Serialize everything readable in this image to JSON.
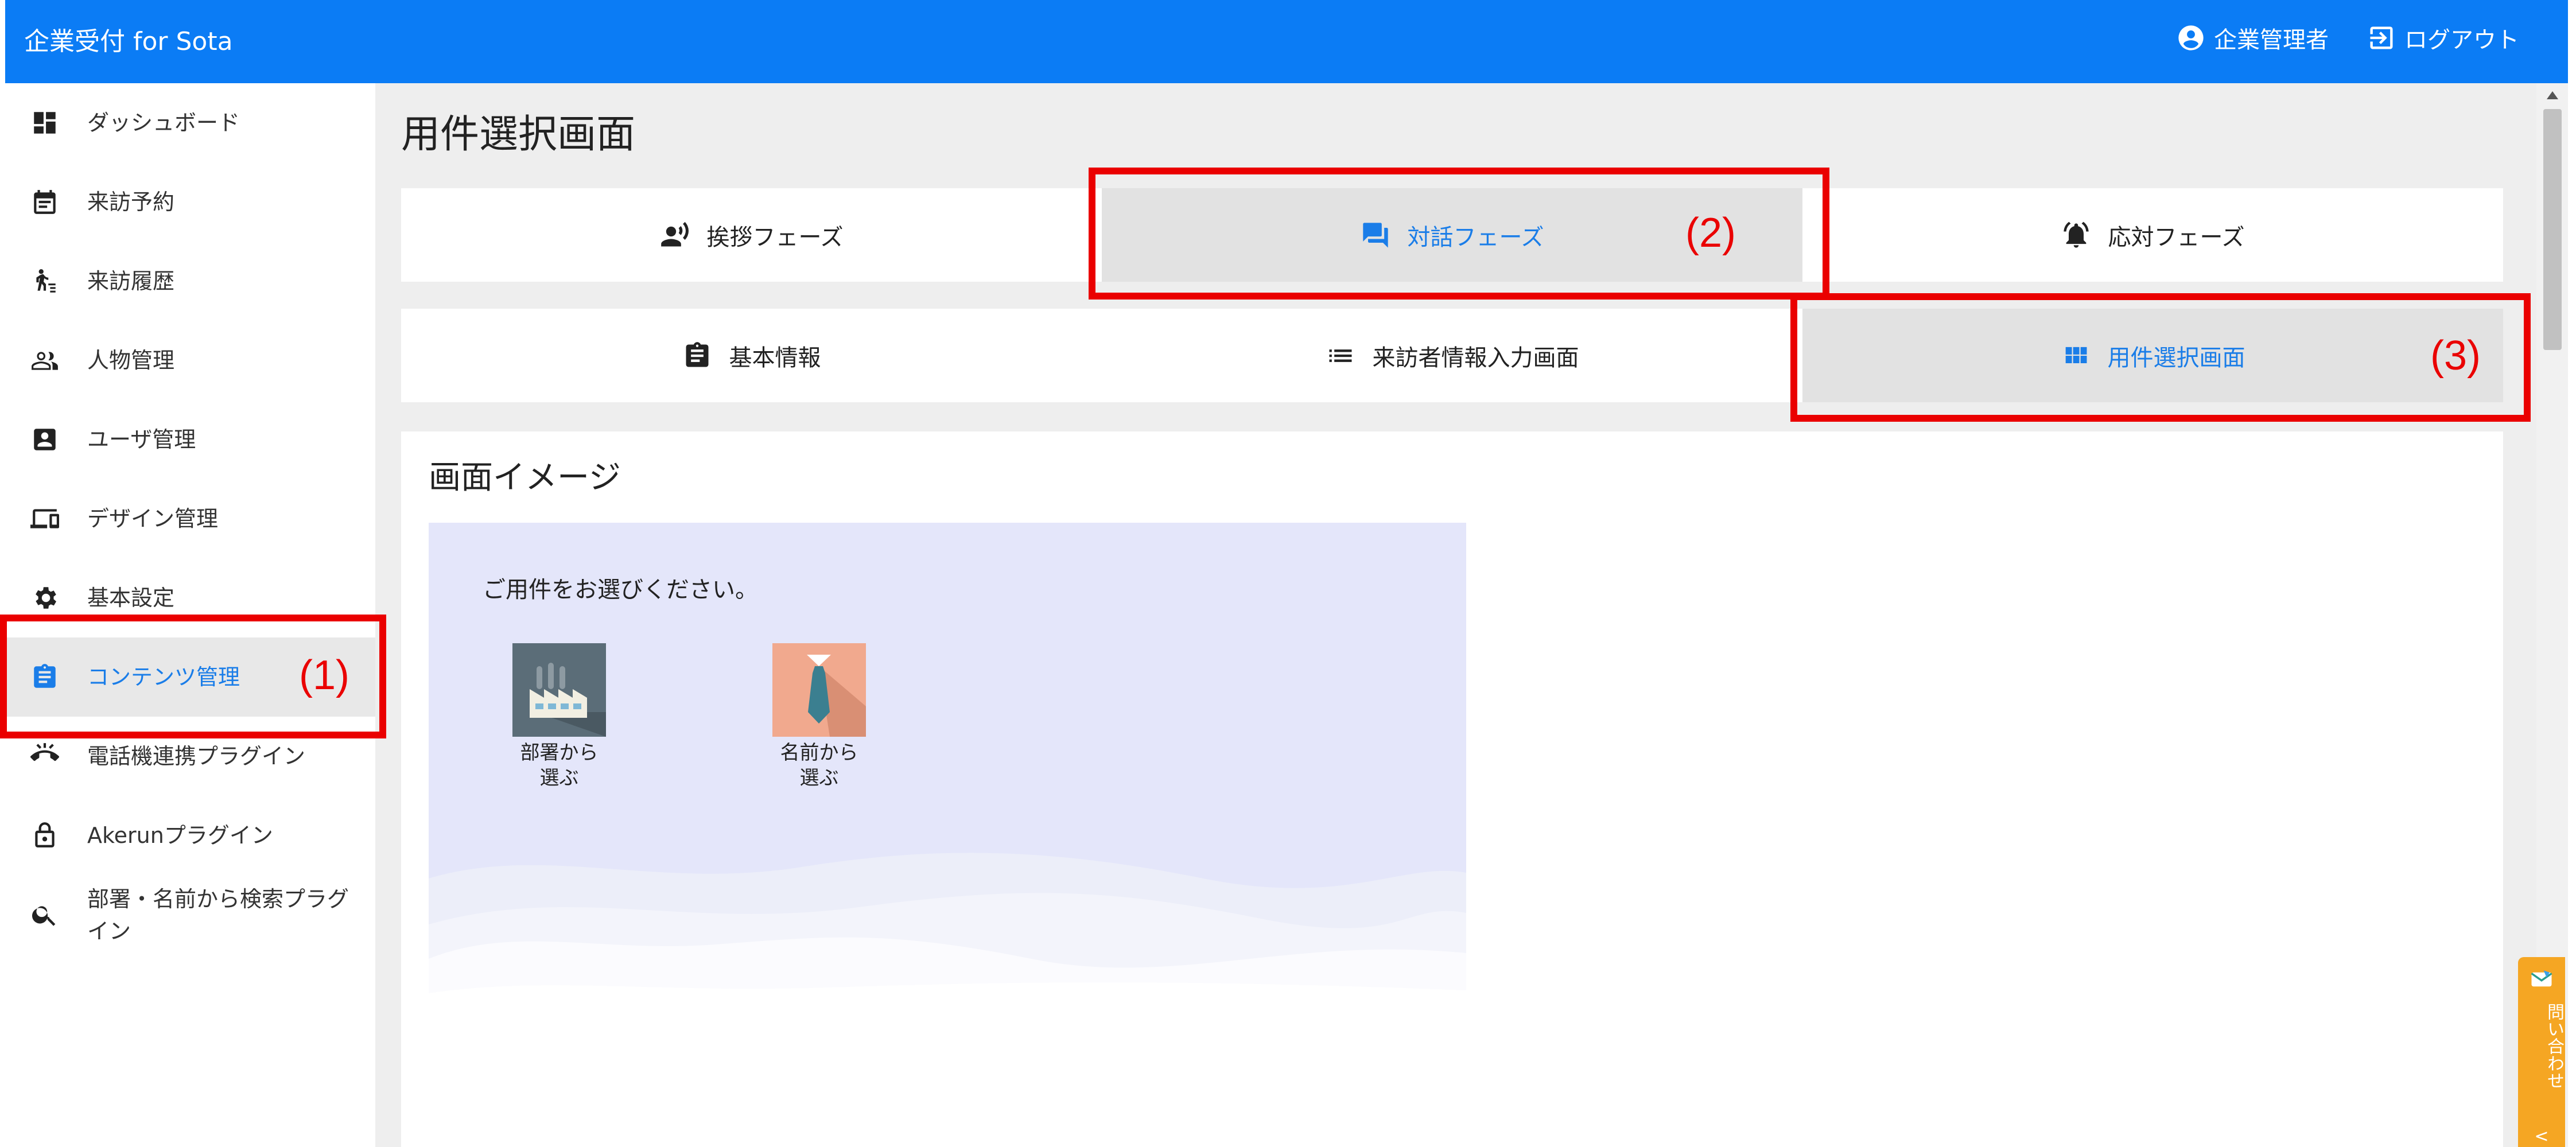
{
  "app": {
    "title": "企業受付 for Sota"
  },
  "header": {
    "user_label": "企業管理者",
    "logout_label": "ログアウト"
  },
  "sidebar": {
    "items": [
      {
        "label": "ダッシュボード",
        "icon": "dashboard-icon"
      },
      {
        "label": "来訪予約",
        "icon": "calendar-icon"
      },
      {
        "label": "来訪履歴",
        "icon": "walker-icon"
      },
      {
        "label": "人物管理",
        "icon": "people-icon"
      },
      {
        "label": "ユーザ管理",
        "icon": "account-box-icon"
      },
      {
        "label": "デザイン管理",
        "icon": "devices-icon"
      },
      {
        "label": "基本設定",
        "icon": "gear-icon"
      },
      {
        "label": "コンテンツ管理",
        "icon": "clipboard-icon",
        "active": true
      },
      {
        "label": "電話機連携プラグイン",
        "icon": "phone-icon"
      },
      {
        "label": "Akerunプラグイン",
        "icon": "lock-icon"
      },
      {
        "label": "部署・名前から検索プラグイン",
        "icon": "search-icon"
      }
    ]
  },
  "main": {
    "title": "用件選択画面",
    "phase_tabs": [
      {
        "label": "挨拶フェーズ",
        "icon": "speaker-person-icon"
      },
      {
        "label": "対話フェーズ",
        "icon": "chat-icon",
        "active": true
      },
      {
        "label": "応対フェーズ",
        "icon": "bell-icon"
      }
    ],
    "screen_tabs": [
      {
        "label": "基本情報",
        "icon": "clipboard-icon"
      },
      {
        "label": "来訪者情報入力画面",
        "icon": "list-icon"
      },
      {
        "label": "用件選択画面",
        "icon": "grid-icon",
        "active": true
      }
    ],
    "card": {
      "title": "画面イメージ",
      "preview": {
        "prompt": "ご用件をお選びください。",
        "choices": [
          {
            "label": "部署から選ぶ",
            "icon": "factory-icon"
          },
          {
            "label": "名前から選ぶ",
            "icon": "necktie-icon"
          }
        ]
      }
    }
  },
  "contact": {
    "label": "問い合わせ",
    "chevron": "<"
  },
  "annotations": [
    {
      "label": "(1)"
    },
    {
      "label": "(2)"
    },
    {
      "label": "(3)"
    }
  ],
  "colors": {
    "header": "#0b7cf5",
    "active": "#1a7de8",
    "annotation": "#ea0000",
    "contact": "#f5a623",
    "preview_bg": "#e4e6fa"
  }
}
